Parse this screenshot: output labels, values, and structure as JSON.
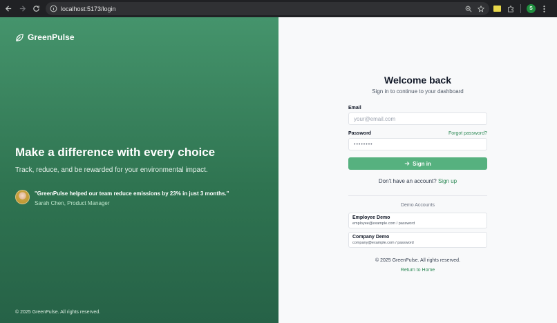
{
  "browser": {
    "url": "localhost:5173/login",
    "profile_initial": "S"
  },
  "hero": {
    "brand_name": "GreenPulse",
    "title": "Make a difference with every choice",
    "subtitle": "Track, reduce, and be rewarded for your environmental impact.",
    "testimonial_quote": "\"GreenPulse helped our team reduce emissions by 23% in just 3 months.\"",
    "testimonial_author": "Sarah Chen, Product Manager",
    "footer": "© 2025 GreenPulse. All rights reserved."
  },
  "login": {
    "title": "Welcome back",
    "subtitle": "Sign in to continue to your dashboard",
    "email_label": "Email",
    "email_placeholder": "your@email.com",
    "password_label": "Password",
    "forgot_password": "Forgot password?",
    "password_value": "••••••••",
    "signin_label": "Sign in",
    "no_account_text": "Don't have an account?",
    "signup_link": "Sign up",
    "demo_heading": "Demo Accounts",
    "demo_accounts": [
      {
        "title": "Employee Demo",
        "credentials": "employee@example.com / password"
      },
      {
        "title": "Company Demo",
        "credentials": "company@example.com / password"
      }
    ],
    "footer": "© 2025 GreenPulse. All rights reserved.",
    "return_home": "Return to Home"
  },
  "colors": {
    "brand_green": "#56b17f",
    "link_green": "#2f8a57",
    "hero_top": "#45946c",
    "hero_bottom": "#266247"
  }
}
